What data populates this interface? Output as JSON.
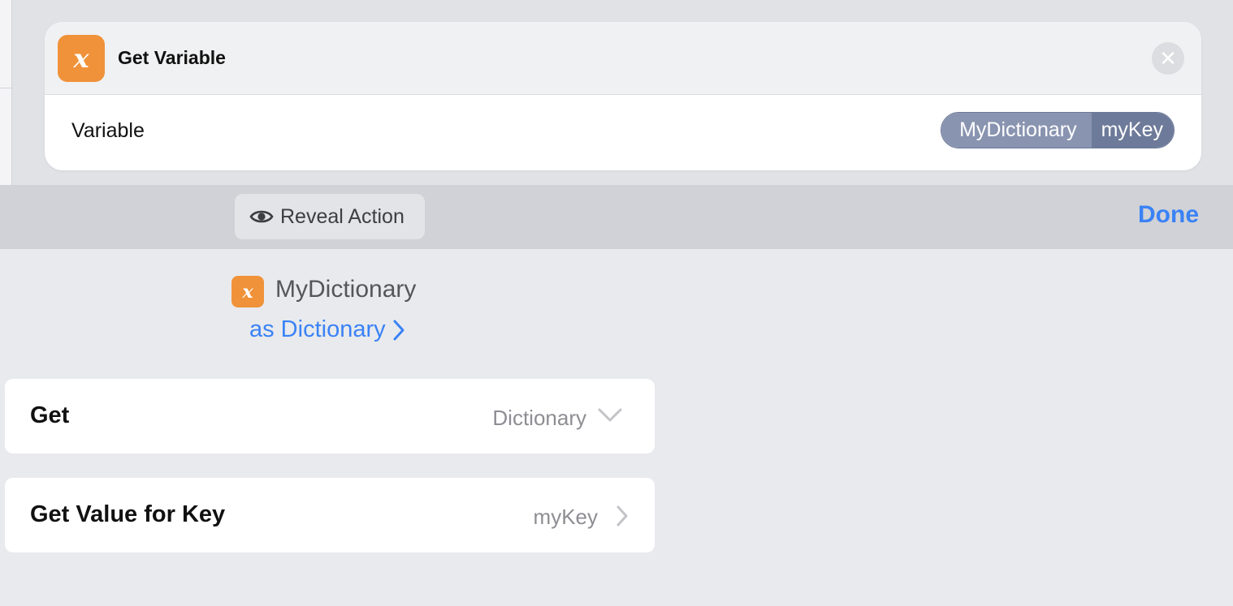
{
  "action_card": {
    "title": "Get Variable",
    "icon": "variable-x-icon",
    "icon_color": "#f0923a",
    "close_icon": "close-icon",
    "field_label": "Variable",
    "token": {
      "variable": "MyDictionary",
      "key": "myKey"
    }
  },
  "toolbar": {
    "reveal_label": "Reveal Action",
    "reveal_icon": "eye-icon",
    "done_label": "Done",
    "accent_color": "#3a82f6"
  },
  "variable_info": {
    "icon": "variable-x-icon",
    "name": "MyDictionary",
    "type_label": "as Dictionary"
  },
  "settings": [
    {
      "label": "Get",
      "value": "Dictionary",
      "icon": "chevron-down-icon"
    },
    {
      "label": "Get Value for Key",
      "value": "myKey",
      "icon": "chevron-right-icon"
    }
  ]
}
